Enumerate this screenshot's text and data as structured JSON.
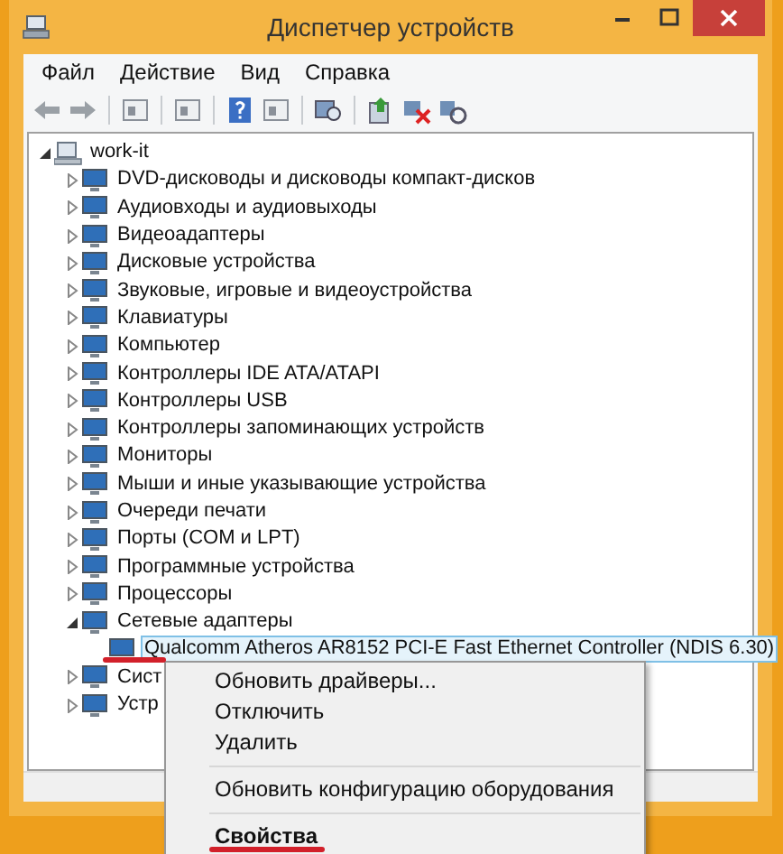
{
  "window": {
    "title": "Диспетчер устройств"
  },
  "menu_bar": [
    "Файл",
    "Действие",
    "Вид",
    "Справка"
  ],
  "tree": {
    "label": "work-it",
    "expanded": true,
    "selected": false,
    "children": [
      {
        "label": "DVD-дисководы и дисководы компакт-дисков",
        "expanded": false,
        "selected": false
      },
      {
        "label": "Аудиовходы и аудиовыходы",
        "expanded": false,
        "selected": false
      },
      {
        "label": "Видеоадаптеры",
        "expanded": false,
        "selected": false
      },
      {
        "label": "Дисковые устройства",
        "expanded": false,
        "selected": false
      },
      {
        "label": "Звуковые, игровые и видеоустройства",
        "expanded": false,
        "selected": false
      },
      {
        "label": "Клавиатуры",
        "expanded": false,
        "selected": false
      },
      {
        "label": "Компьютер",
        "expanded": false,
        "selected": false
      },
      {
        "label": "Контроллеры IDE ATA/ATAPI",
        "expanded": false,
        "selected": false
      },
      {
        "label": "Контроллеры USB",
        "expanded": false,
        "selected": false
      },
      {
        "label": "Контроллеры запоминающих устройств",
        "expanded": false,
        "selected": false
      },
      {
        "label": "Мониторы",
        "expanded": false,
        "selected": false
      },
      {
        "label": "Мыши и иные указывающие устройства",
        "expanded": false,
        "selected": false
      },
      {
        "label": "Очереди печати",
        "expanded": false,
        "selected": false
      },
      {
        "label": "Порты (COM и LPT)",
        "expanded": false,
        "selected": false
      },
      {
        "label": "Программные устройства",
        "expanded": false,
        "selected": false
      },
      {
        "label": "Процессоры",
        "expanded": false,
        "selected": false
      },
      {
        "label": "Сетевые адаптеры",
        "expanded": true,
        "selected": false,
        "children": [
          {
            "label": "Qualcomm Atheros AR8152 PCI-E Fast Ethernet Controller (NDIS 6.30)",
            "selected": true
          }
        ]
      },
      {
        "label": "Сист",
        "expanded": false,
        "selected": false
      },
      {
        "label": "Устр",
        "expanded": false,
        "selected": false
      }
    ]
  },
  "context_menu": [
    {
      "kind": "item",
      "label": "Обновить драйверы..."
    },
    {
      "kind": "item",
      "label": "Отключить"
    },
    {
      "kind": "item",
      "label": "Удалить"
    },
    {
      "kind": "separator"
    },
    {
      "kind": "item",
      "label": "Обновить конфигурацию оборудования"
    },
    {
      "kind": "separator"
    },
    {
      "kind": "default",
      "label": "Свойства"
    }
  ]
}
